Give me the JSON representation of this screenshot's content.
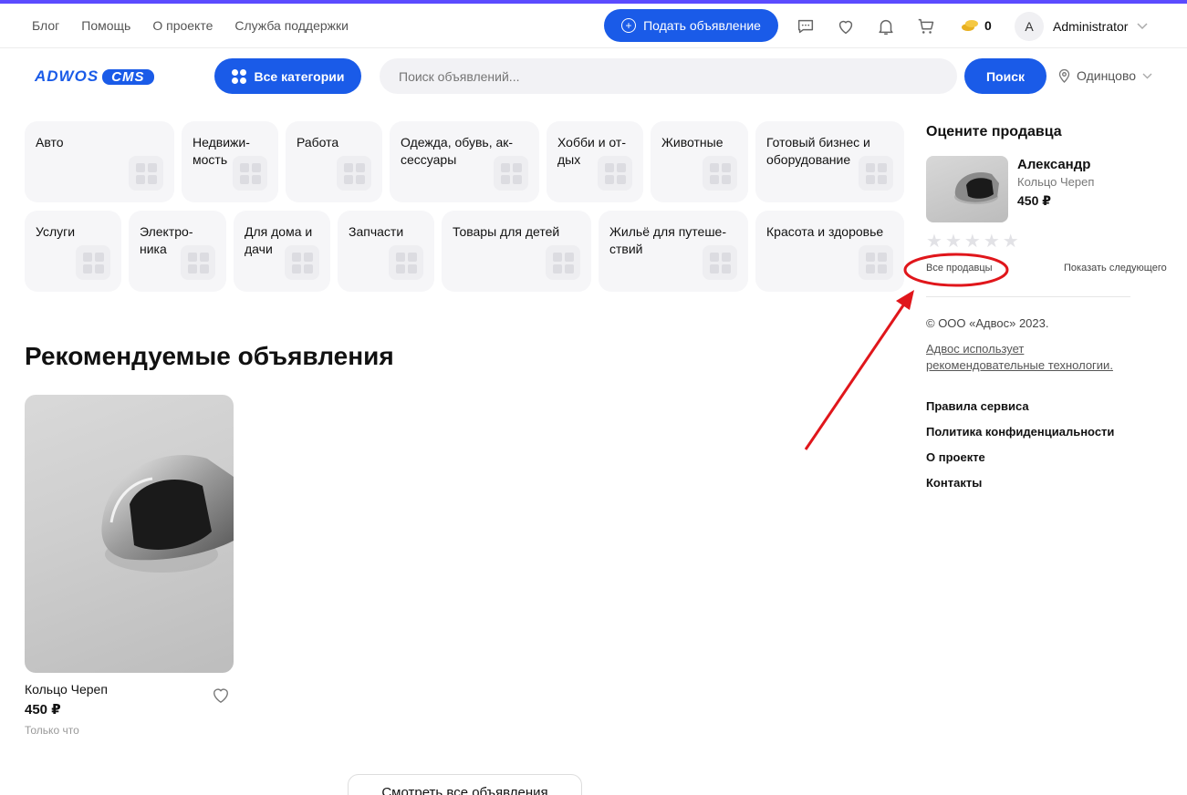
{
  "header": {
    "top_links": [
      "Блог",
      "Помощь",
      "О проекте",
      "Служба поддержки"
    ],
    "post_button": "Подать объявление",
    "icons": [
      "chat-icon",
      "heart-icon",
      "bell-icon",
      "cart-icon"
    ],
    "coins": "0",
    "user_initial": "A",
    "user_name": "Administrator"
  },
  "nav": {
    "logo_part1": "ADWOS",
    "logo_part2": "CMS",
    "categories_button": "Все категории",
    "search_placeholder": "Поиск объявлений...",
    "search_button": "Поиск",
    "location": "Одинцово"
  },
  "categories": [
    "Авто",
    "Недвижи-\nмость",
    "Работа",
    "Одежда, обувь, ак-\nсессуары",
    "Хобби и от-\nдых",
    "Животные",
    "Готовый бизнес и\nоборудование",
    "Услуги",
    "Электро-\nника",
    "Для дома и\nдачи",
    "Запчасти",
    "Товары для детей",
    "Жильё для путеше-\nствий",
    "Красота и здоровье"
  ],
  "recommended": {
    "title": "Рекомендуемые объявления",
    "cards": [
      {
        "title": "Кольцо Череп",
        "price": "450 ₽",
        "subtitle": "Только что"
      }
    ],
    "all_button": "Смотреть все объявления"
  },
  "sidebar": {
    "rate_title": "Оцените продавца",
    "seller_name": "Александр",
    "seller_item": "Кольцо Череп",
    "seller_price": "450 ₽",
    "rating": 0,
    "all_sellers": "Все продавцы",
    "show_next": "Показать следующего",
    "copyright": "© ООО «Адвос» 2023.",
    "tech_link": "Адвос использует рекомендовательные технологии.",
    "footer_links": [
      "Правила сервиса",
      "Политика конфиденциальности",
      "О проекте",
      "Контакты"
    ]
  },
  "colors": {
    "accent": "#1a5be8",
    "top_bar": "#5b4bff",
    "annotation": "#e0161b"
  }
}
